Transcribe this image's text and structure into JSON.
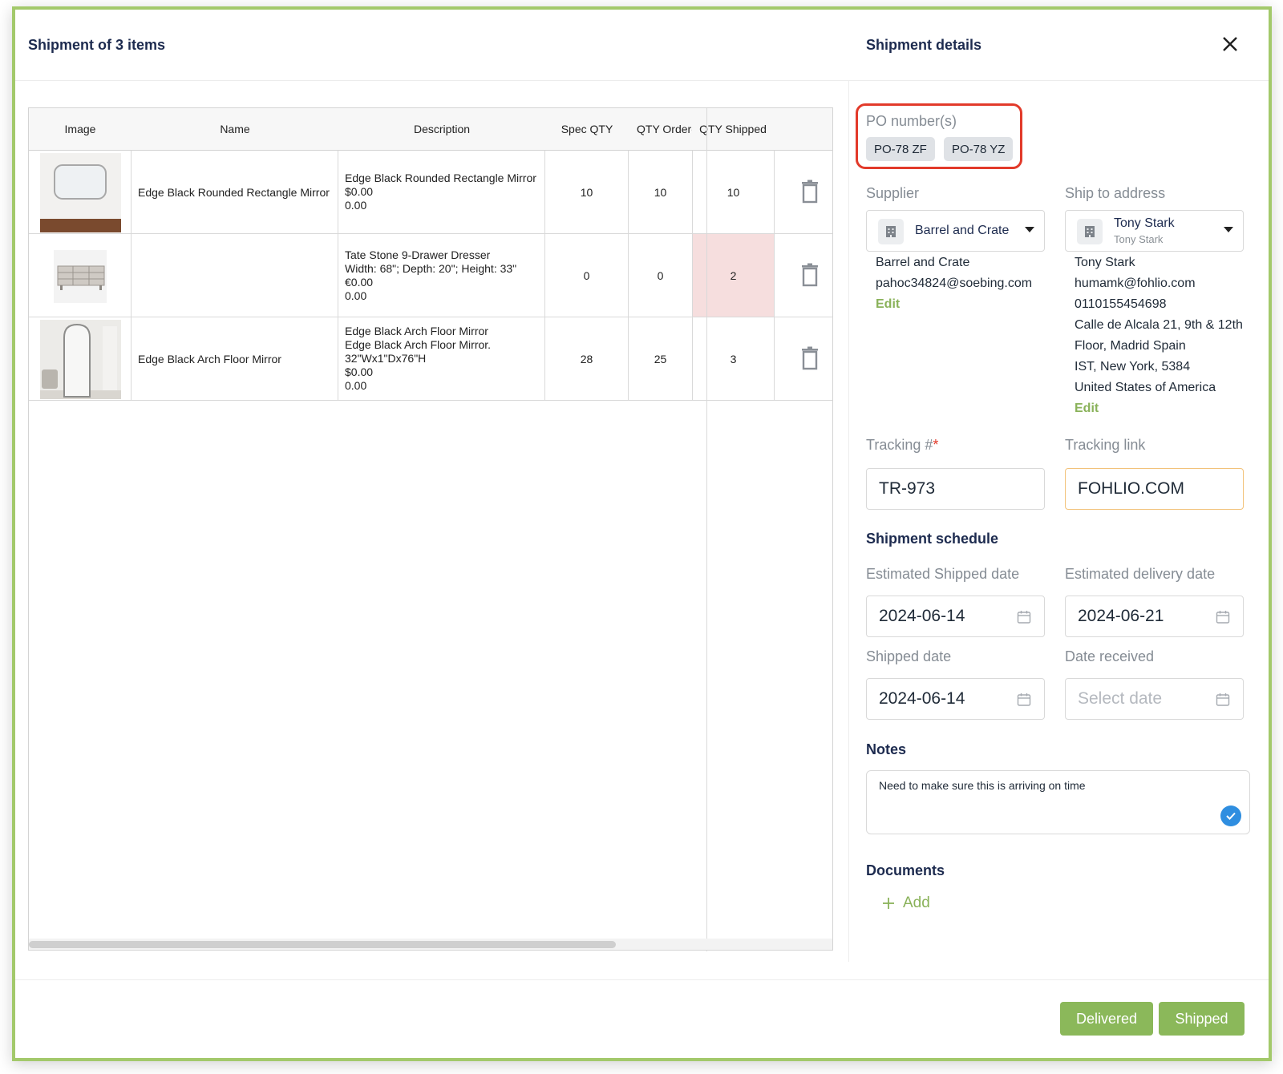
{
  "header": {
    "left_title": "Shipment of 3 items",
    "right_title": "Shipment details"
  },
  "table": {
    "columns": [
      "Image",
      "Name",
      "Description",
      "Spec QTY",
      "QTY Ordered",
      "QTY Shipped"
    ],
    "rows": [
      {
        "image": "rounded-rectangle-mirror-photo",
        "name": "Edge Black Rounded Rectangle Mirror",
        "description": [
          "Edge Black Rounded Rectangle Mirror",
          "$0.00",
          "0.00"
        ],
        "spec_qty": "10",
        "qty_ordered": "10",
        "qty_shipped": "10"
      },
      {
        "image": "dresser-photo",
        "name": "",
        "description": [
          "Tate Stone 9-Drawer Dresser",
          "Width: 68\"; Depth: 20\"; Height: 33\"",
          "€0.00",
          "0.00"
        ],
        "spec_qty": "0",
        "qty_ordered": "0",
        "qty_shipped": "2"
      },
      {
        "image": "arch-floor-mirror-photo",
        "name": "Edge Black Arch Floor Mirror",
        "description": [
          "Edge Black Arch Floor Mirror",
          "Edge Black Arch Floor Mirror.",
          "32\"Wx1\"Dx76\"H",
          "$0.00",
          "0.00"
        ],
        "spec_qty": "28",
        "qty_ordered": "25",
        "qty_shipped": "3"
      }
    ]
  },
  "details": {
    "po_label": "PO number(s)",
    "po_numbers": [
      "PO-78 ZF",
      "PO-78 YZ"
    ],
    "supplier": {
      "label": "Supplier",
      "selected": "Barrel and Crate",
      "name": "Barrel and Crate",
      "email": "pahoc34824@soebing.com",
      "edit": "Edit"
    },
    "ship_to": {
      "label": "Ship to address",
      "selected": "Tony Stark",
      "selected_sub": "Tony Stark",
      "name": "Tony Stark",
      "email": "humamk@fohlio.com",
      "phone": "0110155454698",
      "address_1": "Calle de Alcala 21, 9th & 12th",
      "address_2": "Floor, Madrid Spain",
      "address_3": "IST, New York, 5384",
      "country": "United States of America",
      "edit": "Edit"
    },
    "tracking_number": {
      "label": "Tracking #",
      "required_mark": "*",
      "value": "TR-973"
    },
    "tracking_link": {
      "label": "Tracking link",
      "value": "FOHLIO.COM"
    },
    "schedule": {
      "title": "Shipment schedule",
      "estimated_shipped": {
        "label": "Estimated Shipped date",
        "value": "2024-06-14"
      },
      "estimated_delivery": {
        "label": "Estimated delivery date",
        "value": "2024-06-21"
      },
      "shipped": {
        "label": "Shipped date",
        "value": "2024-06-14"
      },
      "received": {
        "label": "Date received",
        "placeholder": "Select date"
      }
    },
    "notes": {
      "title": "Notes",
      "value": "Need to make sure this is arriving on time"
    },
    "documents": {
      "title": "Documents",
      "add": "Add"
    }
  },
  "footer": {
    "delivered": "Delivered",
    "shipped": "Shipped"
  },
  "colors": {
    "accent": "#8bb85a",
    "border_frame": "#a3c96b",
    "highlight": "#e23a2a",
    "title": "#1d2b4f"
  }
}
